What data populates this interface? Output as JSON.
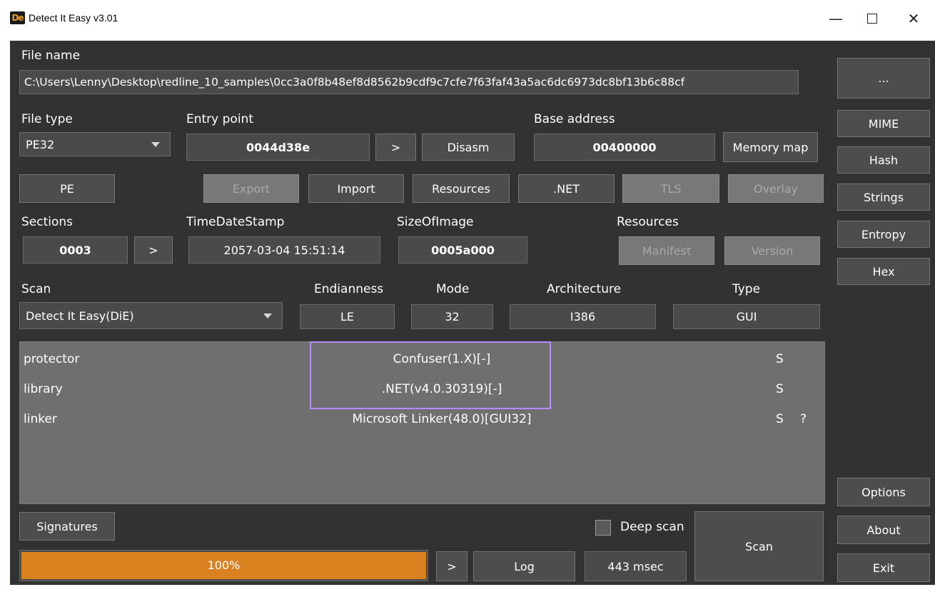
{
  "window": {
    "title": "Detect It Easy v3.01",
    "icon_text": "De",
    "minimize_glyph": "—",
    "close_glyph": "✕"
  },
  "file": {
    "label": "File name",
    "path": "C:\\Users\\Lenny\\Desktop\\redline_10_samples\\0cc3a0f8b48ef8d8562b9cdf9c7cfe7f63faf43a5ac6dc6973dc8bf13b6c88cf",
    "browse_label": "..."
  },
  "file_type": {
    "label": "File type",
    "value": "PE32"
  },
  "entry_point": {
    "label": "Entry point",
    "value": "0044d38e",
    "go_label": ">",
    "disasm_label": "Disasm"
  },
  "base_address": {
    "label": "Base address",
    "value": "00400000",
    "memory_map_label": "Memory map"
  },
  "pe_buttons": {
    "pe": "PE",
    "export": "Export",
    "import": "Import",
    "resources": "Resources",
    "net": ".NET",
    "tls": "TLS",
    "overlay": "Overlay"
  },
  "sections": {
    "label": "Sections",
    "value": "0003",
    "go_label": ">"
  },
  "timedatestamp": {
    "label": "TimeDateStamp",
    "value": "2057-03-04 15:51:14"
  },
  "sizeofimage": {
    "label": "SizeOfImage",
    "value": "0005a000"
  },
  "resources": {
    "label": "Resources",
    "manifest": "Manifest",
    "version": "Version"
  },
  "scan": {
    "label": "Scan",
    "value": "Detect It Easy(DiE)"
  },
  "endianness": {
    "label": "Endianness",
    "value": "LE"
  },
  "mode": {
    "label": "Mode",
    "value": "32"
  },
  "architecture": {
    "label": "Architecture",
    "value": "I386"
  },
  "type": {
    "label": "Type",
    "value": "GUI"
  },
  "results": [
    {
      "kind": "protector",
      "name": "Confuser(1.X)[-]",
      "s": "S",
      "q": ""
    },
    {
      "kind": "library",
      "name": ".NET(v4.0.30319)[-]",
      "s": "S",
      "q": ""
    },
    {
      "kind": "linker",
      "name": "Microsoft Linker(48.0)[GUI32]",
      "s": "S",
      "q": "?"
    }
  ],
  "bottom": {
    "signatures": "Signatures",
    "deep_scan": "Deep scan",
    "scan": "Scan",
    "progress_text": "100%",
    "progress_value": 1.0,
    "go_label": ">",
    "log": "Log",
    "time": "443 msec"
  },
  "side": {
    "mime": "MIME",
    "hash": "Hash",
    "strings": "Strings",
    "entropy": "Entropy",
    "hex": "Hex",
    "options": "Options",
    "about": "About",
    "exit": "Exit"
  },
  "colors": {
    "background": "#323232",
    "panel": "#6f6f6f",
    "progress": "#d9821f",
    "highlight": "#b98cff"
  }
}
